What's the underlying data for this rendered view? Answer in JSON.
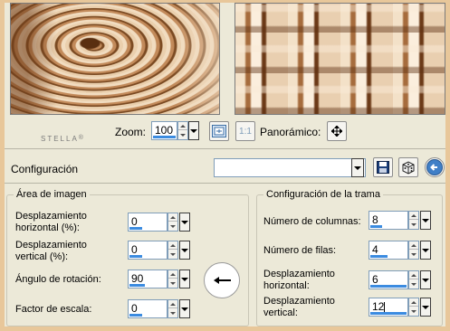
{
  "preview": {
    "watermark": "STELLA",
    "zoom_label": "Zoom:",
    "zoom_value": "100",
    "one_to_one_label": "1:1",
    "pan_label": "Panorámico:"
  },
  "config": {
    "label": "Configuración",
    "preset_value": ""
  },
  "image_area": {
    "title": "Área de imagen",
    "fields": [
      {
        "label_line1": "Desplazamiento",
        "label_line2": "horizontal (%):",
        "value": "0"
      },
      {
        "label_line1": "Desplazamiento",
        "label_line2": "vertical (%):",
        "value": "0"
      },
      {
        "label_line1": "Ángulo de rotación:",
        "label_line2": "",
        "value": "90"
      },
      {
        "label_line1": "Factor de escala:",
        "label_line2": "",
        "value": "0"
      }
    ]
  },
  "tile_config": {
    "title": "Configuración de la trama",
    "fields": [
      {
        "label_line1": "Número de columnas:",
        "label_line2": "",
        "value": "8"
      },
      {
        "label_line1": "Número de filas:",
        "label_line2": "",
        "value": "4"
      },
      {
        "label_line1": "Desplazamiento",
        "label_line2": "horizontal:",
        "value": "6"
      },
      {
        "label_line1": "Desplazamiento",
        "label_line2": "vertical:",
        "value": "12"
      }
    ]
  },
  "colors": {
    "window_bg": "#ece9d8",
    "outer_border": "#e8c79a",
    "accent_bar": "#3b8be0"
  }
}
